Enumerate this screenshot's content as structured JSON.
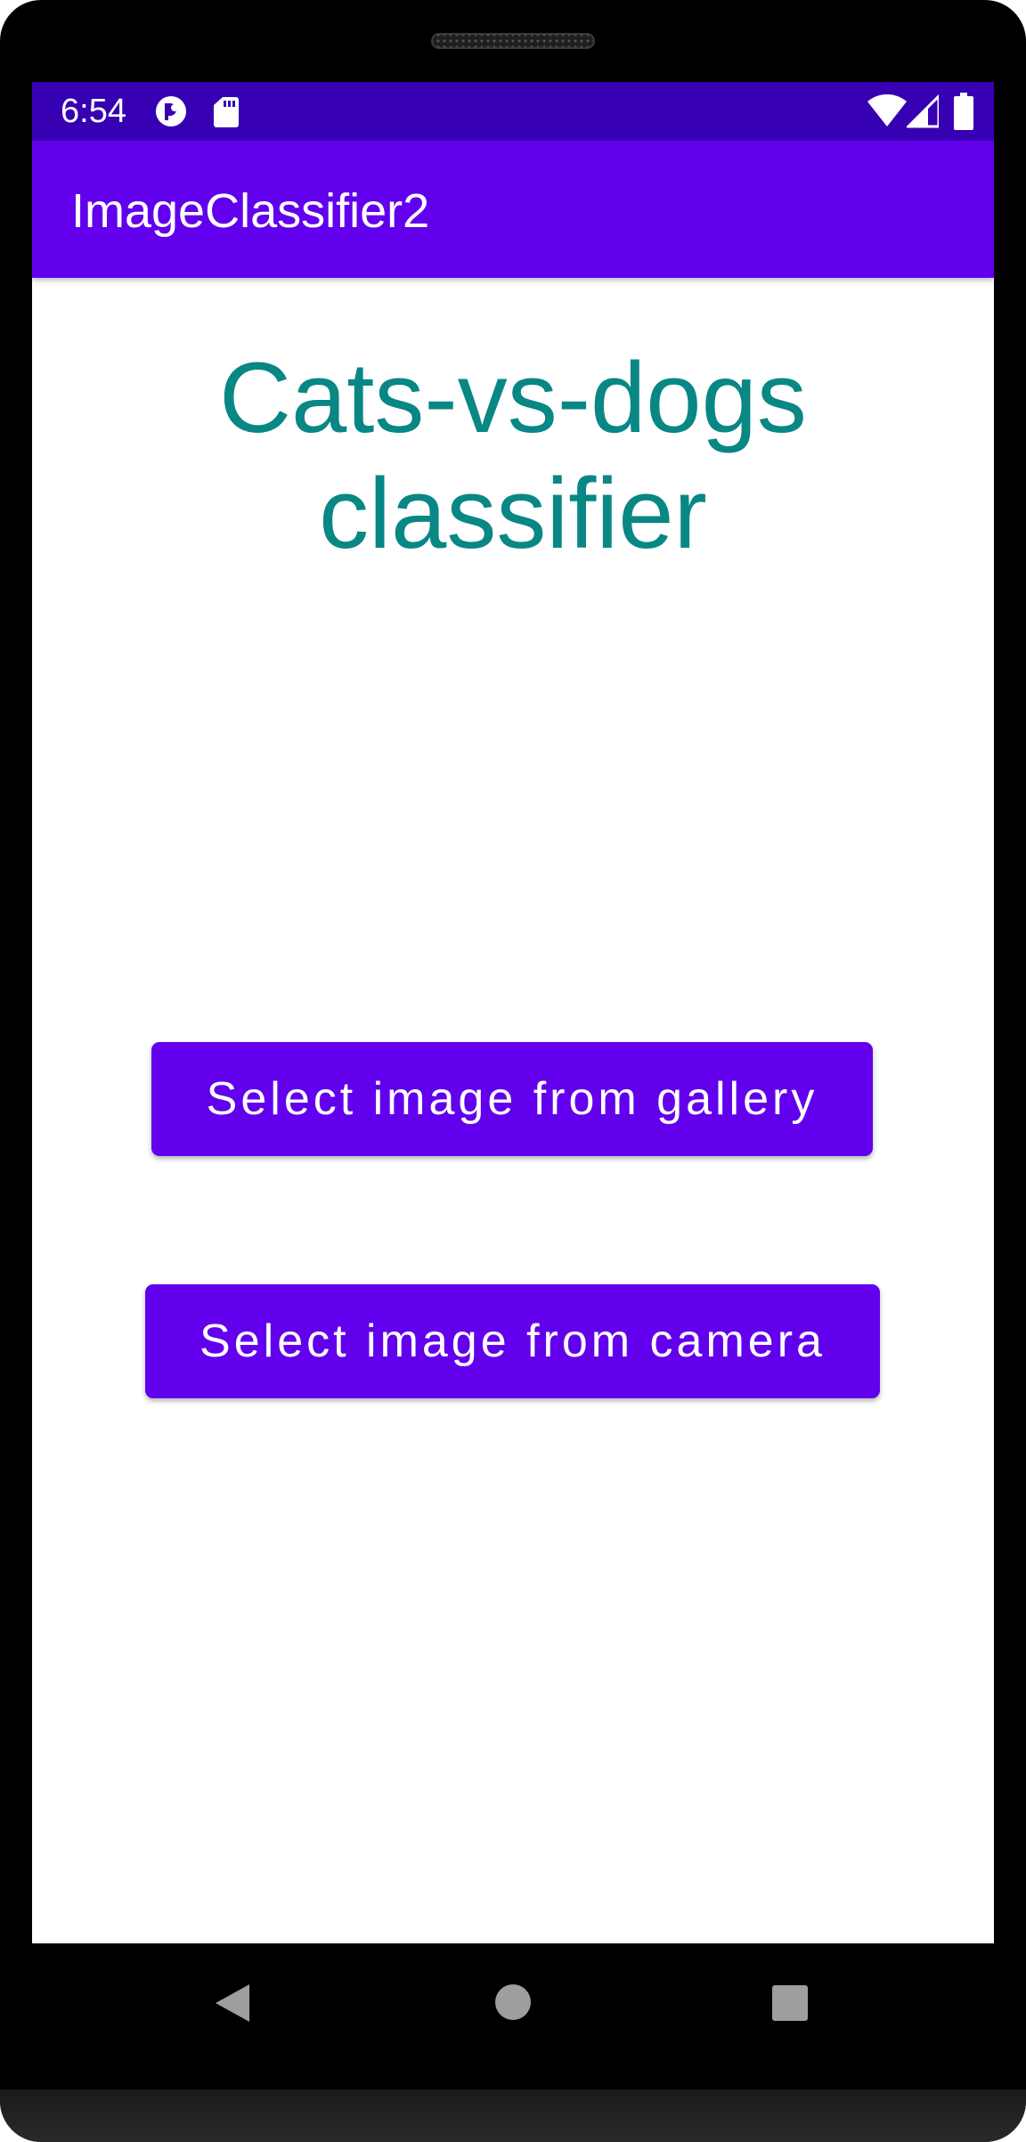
{
  "status_bar": {
    "time": "6:54",
    "icons": [
      "notification-app-icon",
      "sd-card-icon",
      "wifi-icon",
      "cell-signal-icon",
      "battery-icon"
    ]
  },
  "app_bar": {
    "title": "ImageClassifier2"
  },
  "main": {
    "headline_line1": "Cats-vs-dogs",
    "headline_line2": "classifier",
    "gallery_button_label": "Select image from gallery",
    "camera_button_label": "Select image from camera"
  },
  "nav_bar": {
    "buttons": [
      "back-icon",
      "home-icon",
      "recents-icon"
    ]
  },
  "colors": {
    "status_bar": "#3700b3",
    "primary": "#6200ee",
    "headline_text": "#088785",
    "background": "#ffffff"
  }
}
